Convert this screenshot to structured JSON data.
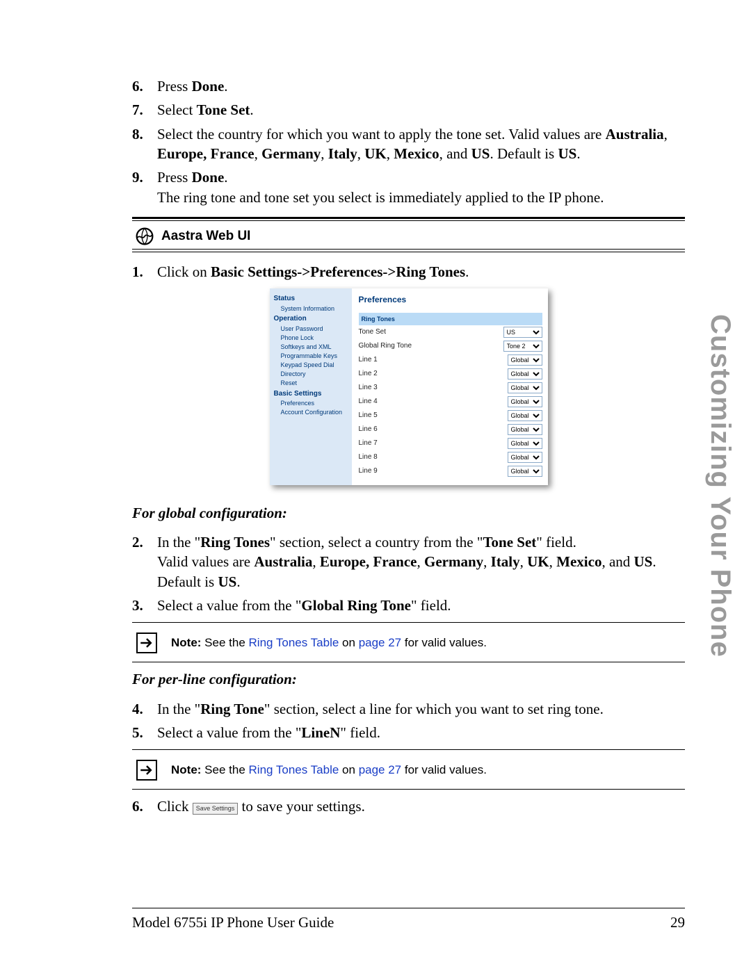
{
  "steps_a": [
    {
      "n": "6.",
      "parts": [
        "Press ",
        "Done",
        "."
      ]
    },
    {
      "n": "7.",
      "parts": [
        "Select ",
        "Tone Set",
        "."
      ]
    },
    {
      "n": "8.",
      "text_a": "Select the country for which you want to apply the tone set. Valid values are ",
      "bold_a": "Australia",
      "comma1": ", ",
      "bold_b": "Europe, France",
      "comma2": ", ",
      "bold_c": "Germany",
      "comma3": ", ",
      "bold_d": "Italy",
      "comma4": ", ",
      "bold_e": "UK",
      "comma5": ", ",
      "bold_f": "Mexico",
      "comma6": ", and ",
      "bold_g": "US",
      "tail": ". Default is ",
      "bold_h": "US",
      "dot": "."
    },
    {
      "n": "9.",
      "parts": [
        "Press ",
        "Done",
        "."
      ],
      "extra": "The ring tone and tone set you select is immediately applied to the IP phone."
    }
  ],
  "section_header": "Aastra Web UI",
  "step1": {
    "n": "1.",
    "pre": "Click on ",
    "bold": "Basic Settings->Preferences->Ring Tones",
    "post": "."
  },
  "screenshot": {
    "side": {
      "categories": [
        {
          "label": "Status",
          "items": [
            "System Information"
          ]
        },
        {
          "label": "Operation",
          "items": [
            "User Password",
            "Phone Lock",
            "Softkeys and XML",
            "Programmable Keys",
            "Keypad Speed Dial",
            "Directory",
            "Reset"
          ]
        },
        {
          "label": "Basic Settings",
          "items": [
            "Preferences",
            "Account Configuration"
          ]
        }
      ]
    },
    "main": {
      "title": "Preferences",
      "band": "Ring Tones",
      "rows": [
        {
          "label": "Tone Set",
          "value": "US",
          "wide": true
        },
        {
          "label": "Global Ring Tone",
          "value": "Tone 2",
          "wide": true
        },
        {
          "label": "Line 1",
          "value": "Global"
        },
        {
          "label": "Line 2",
          "value": "Global"
        },
        {
          "label": "Line 3",
          "value": "Global"
        },
        {
          "label": "Line 4",
          "value": "Global"
        },
        {
          "label": "Line 5",
          "value": "Global"
        },
        {
          "label": "Line 6",
          "value": "Global"
        },
        {
          "label": "Line 7",
          "value": "Global"
        },
        {
          "label": "Line 8",
          "value": "Global"
        },
        {
          "label": "Line 9",
          "value": "Global"
        }
      ]
    }
  },
  "subhead_global": "For global configuration:",
  "step2": {
    "n": "2.",
    "a": "In the \"",
    "b": "Ring Tones",
    "c": "\" section, select a country from the \"",
    "d": "Tone Set",
    "e": "\" field.",
    "line2a": "Valid values are ",
    "vals": [
      "Australia",
      "Europe, France",
      "Germany",
      "Italy",
      "UK",
      "Mexico",
      "US"
    ],
    "line2b": ". Default is ",
    "def": "US",
    "dot": "."
  },
  "step3": {
    "n": "3.",
    "a": "Select a value from the \"",
    "b": "Global Ring Tone",
    "c": "\" field."
  },
  "note": {
    "label": "Note:",
    "pre": " See the ",
    "link1": "Ring Tones Table",
    "mid": " on ",
    "link2": "page 27",
    "post": " for valid values."
  },
  "subhead_perline": "For per-line configuration:",
  "step4": {
    "n": "4.",
    "a": "In the \"",
    "b": "Ring Tone",
    "c": "\" section, select a line for which you want to set ring tone."
  },
  "step5": {
    "n": "5.",
    "a": "Select a value from the \"",
    "b": "LineN",
    "c": "\" field."
  },
  "step6": {
    "n": "6.",
    "a": "Click ",
    "btn": "Save Settings",
    "b": " to save your settings."
  },
  "side_tab": "Customizing Your Phone",
  "footer_left": "Model 6755i IP Phone User Guide",
  "footer_right": "29"
}
